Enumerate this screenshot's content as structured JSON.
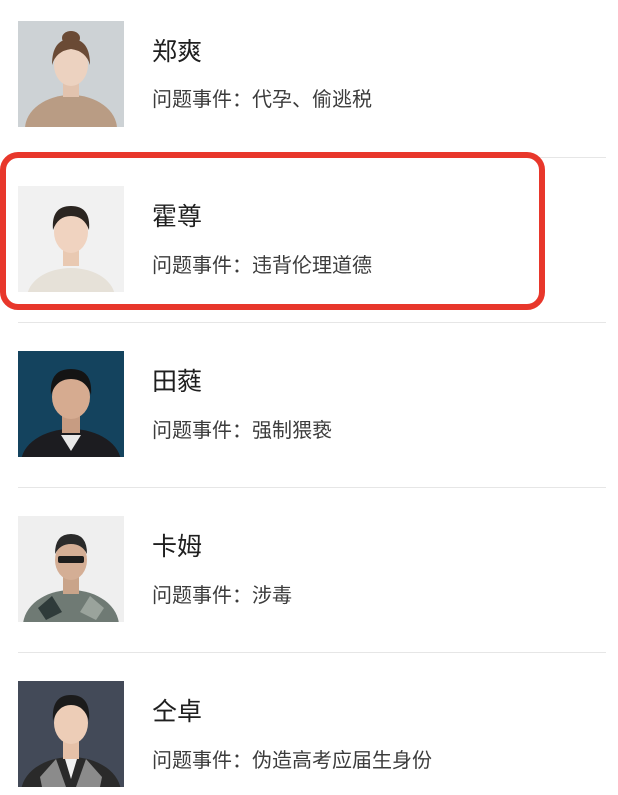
{
  "issue_label_prefix": "问题事件：",
  "highlight_color": "#e8372b",
  "people": [
    {
      "name": "郑爽",
      "issue": "问题事件：代孕、偷逃税",
      "avatar": "portrait-woman-beige-background"
    },
    {
      "name": "霍尊",
      "issue": "问题事件：违背伦理道德",
      "avatar": "portrait-man-white-background"
    },
    {
      "name": "田蕤",
      "issue": "问题事件：强制猥亵",
      "avatar": "portrait-man-dark-blue-background"
    },
    {
      "name": "卡姆",
      "issue": "问题事件：涉毒",
      "avatar": "portrait-man-patterned-shirt"
    },
    {
      "name": "仝卓",
      "issue": "问题事件：伪造高考应届生身份",
      "avatar": "portrait-man-patterned-suit"
    }
  ],
  "highlighted_index": 1
}
